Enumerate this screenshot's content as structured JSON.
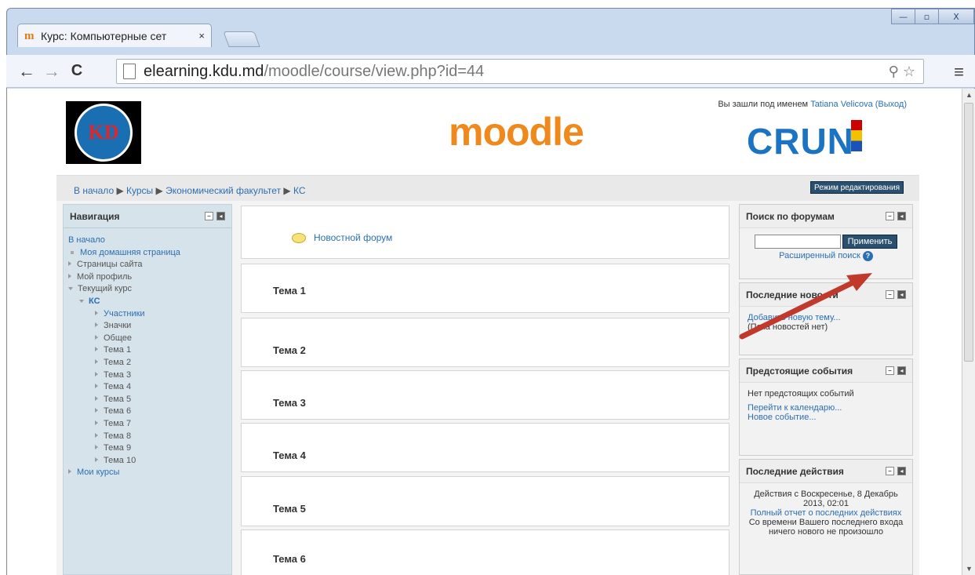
{
  "browser": {
    "tab_title": "Курс: Компьютерные сет",
    "tab_close": "×",
    "url_host": "elearning.kdu.md",
    "url_path": "/moodle/course/view.php?id=44",
    "back_icon": "←",
    "forward_icon": "→",
    "reload_icon": "C",
    "menu_icon": "≡",
    "zoom_icon": "⚲",
    "star_icon": "☆",
    "win_min": "—",
    "win_max": "▫",
    "win_close": "X"
  },
  "header": {
    "login_prefix": "Вы зашли под именем ",
    "login_user": "Tatiana Velicova",
    "login_logout": "(Выход)",
    "logo_moodle": "moodle",
    "logo_kdu": "KD",
    "logo_crun": "CRUN"
  },
  "breadcrumb": {
    "home": "В начало",
    "sep": " ▶ ",
    "courses": "Курсы",
    "faculty": "Экономический факультет",
    "course": "КС"
  },
  "edit_button": "Режим редактирования",
  "navigation": {
    "title": "Навигация",
    "home": "В начало",
    "my_home": "Моя домашняя страница",
    "site_pages": "Страницы сайта",
    "my_profile": "Мой профиль",
    "current_course": "Текущий курс",
    "course": "КС",
    "course_items": [
      "Участники",
      "Значки",
      "Общее",
      "Тема 1",
      "Тема 2",
      "Тема 3",
      "Тема 4",
      "Тема 5",
      "Тема 6",
      "Тема 7",
      "Тема 8",
      "Тема 9",
      "Тема 10"
    ],
    "my_courses": "Мои курсы"
  },
  "forum_link": "Новостной форум",
  "sections": [
    "Тема 1",
    "Тема 2",
    "Тема 3",
    "Тема 4",
    "Тема 5",
    "Тема 6"
  ],
  "search_forums": {
    "title": "Поиск по форумам",
    "button": "Применить",
    "advanced": "Расширенный поиск"
  },
  "news": {
    "title": "Последние новости",
    "add": "Добавить новую тему...",
    "none": "(Пока новостей нет)"
  },
  "events": {
    "title": "Предстоящие события",
    "none": "Нет предстоящих событий",
    "calendar": "Перейти к календарю...",
    "new_event": "Новое событие..."
  },
  "activity": {
    "title": "Последние действия",
    "since": "Действия с Воскресенье, 8 Декабрь 2013, 02:01",
    "full_report": "Полный отчет о последних действиях",
    "nothing_new": "Со времени Вашего последнего входа ничего нового не произошло"
  },
  "colors": {
    "link": "#2a6fb3",
    "moodle_orange": "#f0891c",
    "arrow": "#c0392b",
    "nav_bg": "#d7e3eb"
  }
}
